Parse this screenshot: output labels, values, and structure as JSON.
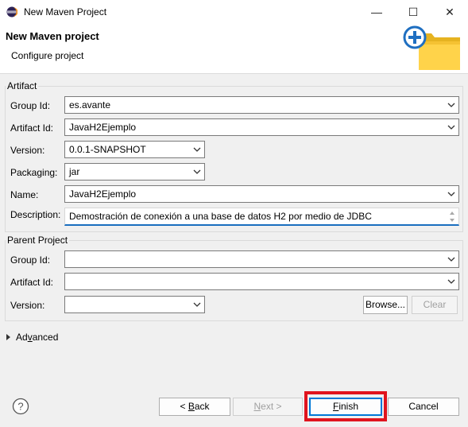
{
  "window": {
    "title": "New Maven Project",
    "controls": {
      "minimize": "—",
      "maximize": "☐",
      "close": "✕"
    }
  },
  "header": {
    "title": "New Maven project",
    "subtitle": "Configure project",
    "icon": "new-maven-project-folder-icon"
  },
  "artifact": {
    "legend": "Artifact",
    "group_id": {
      "label": "Group Id:",
      "value": "es.avante"
    },
    "artifact_id": {
      "label": "Artifact Id:",
      "value": "JavaH2Ejemplo"
    },
    "version": {
      "label": "Version:",
      "value": "0.0.1-SNAPSHOT"
    },
    "packaging": {
      "label": "Packaging:",
      "value": "jar"
    },
    "name": {
      "label": "Name:",
      "value": "JavaH2Ejemplo"
    },
    "description": {
      "label": "Description:",
      "value": "Demostración de conexión a una base de datos H2 por medio de JDBC"
    }
  },
  "parent": {
    "legend": "Parent Project",
    "group_id": {
      "label": "Group Id:",
      "value": ""
    },
    "artifact_id": {
      "label": "Artifact Id:",
      "value": ""
    },
    "version": {
      "label": "Version:",
      "value": ""
    },
    "browse_label": "Browse...",
    "clear_label": "Clear"
  },
  "advanced": {
    "label_prefix": "Ad",
    "label_mnemonic": "v",
    "label_suffix": "anced"
  },
  "buttons": {
    "back": {
      "prefix": "< ",
      "mnemonic": "B",
      "suffix": "ack"
    },
    "next": {
      "mnemonic": "N",
      "suffix": "ext >"
    },
    "finish": {
      "mnemonic": "F",
      "suffix": "inish"
    },
    "cancel": "Cancel"
  },
  "colors": {
    "accent": "#0078d7",
    "highlight": "#e0141e",
    "description_underline": "#1a6fbf"
  }
}
